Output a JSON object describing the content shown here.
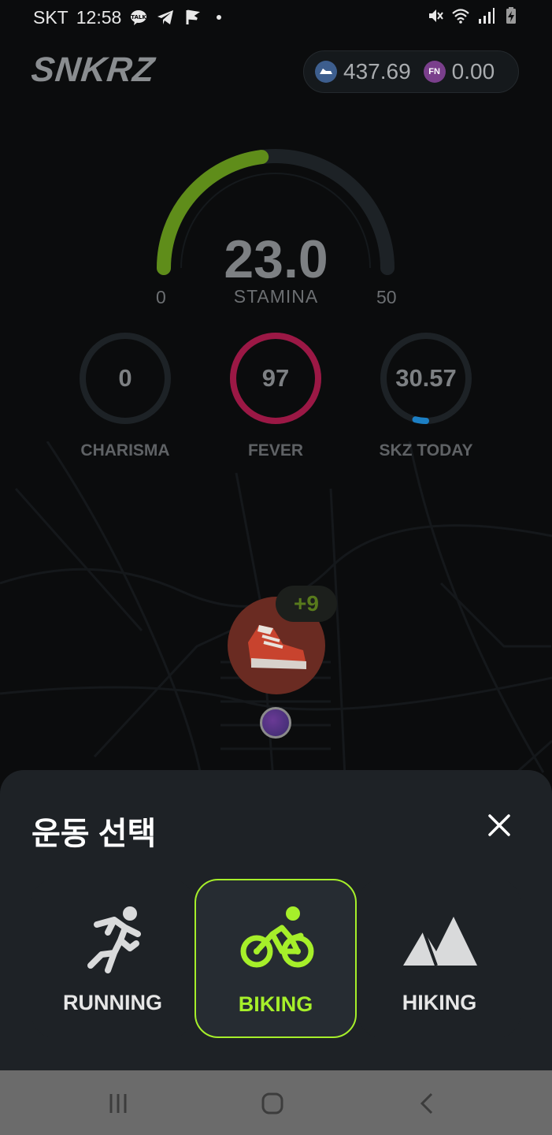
{
  "status_bar": {
    "carrier": "SKT",
    "time": "12:58",
    "left_icons": [
      "kakaotalk-icon",
      "telegram-icon",
      "flag-icon",
      "dot-icon"
    ],
    "right_icons": [
      "mute-icon",
      "wifi-icon",
      "signal-icon",
      "battery-charging-icon"
    ]
  },
  "header": {
    "logo": "SNKRZ",
    "balances": [
      {
        "icon": "snk-coin-icon",
        "value": "437.69"
      },
      {
        "icon": "fnz-coin-icon",
        "value": "0.00"
      }
    ]
  },
  "stamina": {
    "value": "23.0",
    "label": "STAMINA",
    "min": "0",
    "max": "50",
    "fraction": 0.46,
    "color": "#5f8d1a"
  },
  "stats": [
    {
      "value": "0",
      "label": "CHARISMA",
      "fraction": 0,
      "color": "#2a2e31"
    },
    {
      "value": "97",
      "label": "FEVER",
      "fraction": 1.0,
      "color": "#9b1845"
    },
    {
      "value": "30.57",
      "label": "SKZ TODAY",
      "fraction": 0.04,
      "color": "#1c7fc4"
    }
  ],
  "map": {
    "marker_badge": "+9",
    "marker_icon": "sneaker-icon",
    "location_icon": "current-location-icon"
  },
  "sheet": {
    "title": "운동 선택",
    "close_icon": "close-icon",
    "activities": [
      {
        "label": "RUNNING",
        "icon": "running-icon",
        "selected": false
      },
      {
        "label": "BIKING",
        "icon": "biking-icon",
        "selected": true
      },
      {
        "label": "HIKING",
        "icon": "hiking-icon",
        "selected": false
      }
    ],
    "accent": "#a6ef2a"
  },
  "nav_bar": {
    "buttons": [
      "recent-apps-icon",
      "home-icon",
      "back-icon"
    ]
  }
}
